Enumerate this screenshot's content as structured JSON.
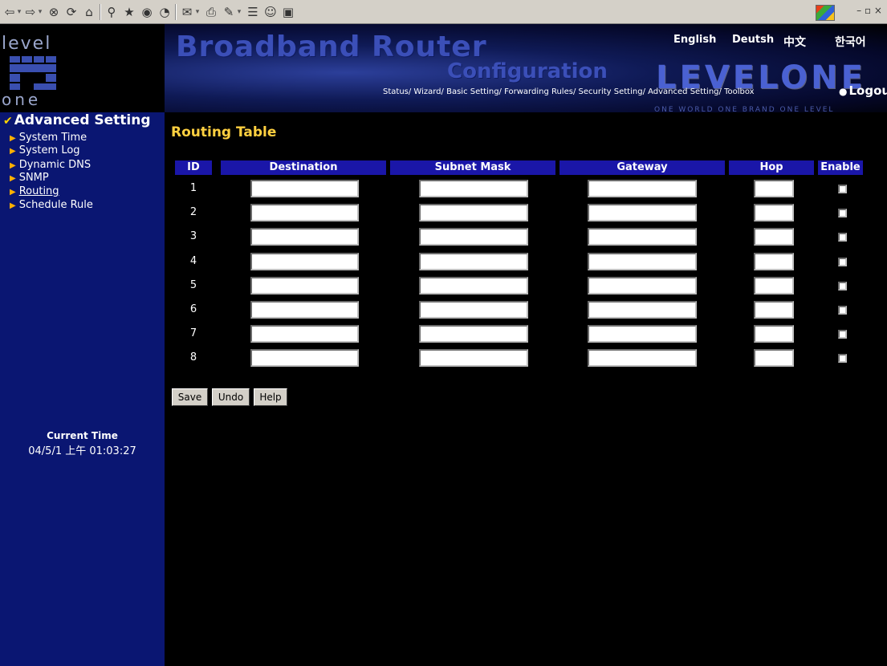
{
  "toolbar": {
    "window_controls": "– ▫ ×"
  },
  "logo": {
    "top_text": "level",
    "bottom_text": "one"
  },
  "sidebar": {
    "section_title": "Advanced Setting",
    "items": [
      {
        "label": "System Time"
      },
      {
        "label": "System Log"
      },
      {
        "label": "Dynamic DNS"
      },
      {
        "label": "SNMP"
      },
      {
        "label": "Routing"
      },
      {
        "label": "Schedule Rule"
      }
    ],
    "active_item": "Routing",
    "current_time_label": "Current Time",
    "current_time_value": "04/5/1 上午 01:03:27"
  },
  "banner": {
    "title": "Broadband Router",
    "subtitle": "Configuration",
    "brand": "LEVELONE",
    "slogan": "ONE WORLD  ONE BRAND  ONE LEVEL",
    "languages": [
      "English",
      "Deutsh",
      "中文",
      "한국어"
    ],
    "nav_links": [
      "Status/",
      "Wizard/",
      "Basic Setting/",
      "Forwarding Rules/",
      "Security Setting/",
      "Advanced Setting/",
      "Toolbox"
    ],
    "logout": "Logout"
  },
  "main": {
    "title": "Routing Table",
    "columns": [
      "ID",
      "Destination",
      "Subnet Mask",
      "Gateway",
      "Hop",
      "Enable"
    ],
    "rows": [
      {
        "id": "1",
        "destination": "",
        "subnet_mask": "",
        "gateway": "",
        "hop": "",
        "enabled": false
      },
      {
        "id": "2",
        "destination": "",
        "subnet_mask": "",
        "gateway": "",
        "hop": "",
        "enabled": false
      },
      {
        "id": "3",
        "destination": "",
        "subnet_mask": "",
        "gateway": "",
        "hop": "",
        "enabled": false
      },
      {
        "id": "4",
        "destination": "",
        "subnet_mask": "",
        "gateway": "",
        "hop": "",
        "enabled": false
      },
      {
        "id": "5",
        "destination": "",
        "subnet_mask": "",
        "gateway": "",
        "hop": "",
        "enabled": false
      },
      {
        "id": "6",
        "destination": "",
        "subnet_mask": "",
        "gateway": "",
        "hop": "",
        "enabled": false
      },
      {
        "id": "7",
        "destination": "",
        "subnet_mask": "",
        "gateway": "",
        "hop": "",
        "enabled": false
      },
      {
        "id": "8",
        "destination": "",
        "subnet_mask": "",
        "gateway": "",
        "hop": "",
        "enabled": false
      }
    ],
    "buttons": {
      "save": "Save",
      "undo": "Undo",
      "help": "Help"
    }
  },
  "colors": {
    "sidebar_bg": "#0a1672",
    "header_cell_bg": "#1a16a8",
    "title_yellow": "#ffd040"
  }
}
